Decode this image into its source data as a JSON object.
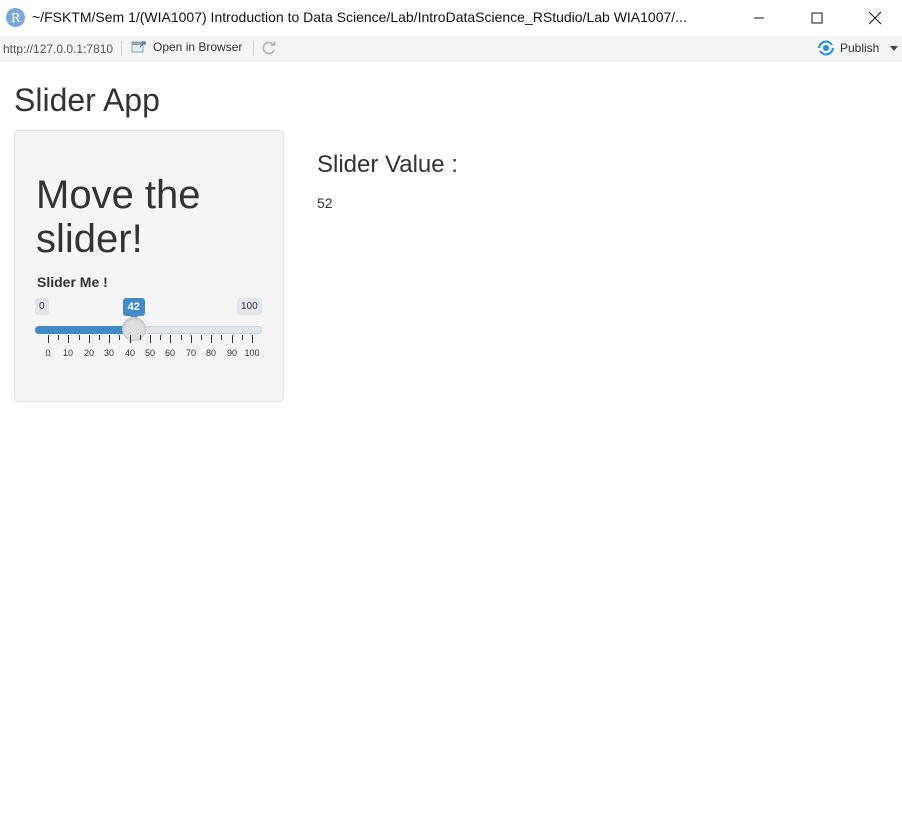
{
  "window": {
    "title": "~/FSKTM/Sem 1/(WIA1007) Introduction to Data Science/Lab/IntroDataScience_RStudio/Lab WIA1007/...",
    "logo_letter": "R"
  },
  "toolbar": {
    "url": "http://127.0.0.1:7810",
    "open_in_browser": "Open in Browser",
    "publish": "Publish"
  },
  "app": {
    "title": "Slider App",
    "sidebar": {
      "heading": "Move the slider!",
      "slider": {
        "label": "Slider Me !",
        "min": 0,
        "max": 100,
        "value": 42,
        "min_text": "0",
        "max_text": "100",
        "value_text": "42",
        "tick_labels": [
          "0",
          "10",
          "20",
          "30",
          "40",
          "50",
          "60",
          "70",
          "80",
          "90",
          "100"
        ]
      }
    },
    "main": {
      "heading": "Slider Value :",
      "value": "52"
    }
  },
  "colors": {
    "accent": "#428bca",
    "panel_bg": "#f5f5f5",
    "publish_icon": "#1f8fd6"
  }
}
